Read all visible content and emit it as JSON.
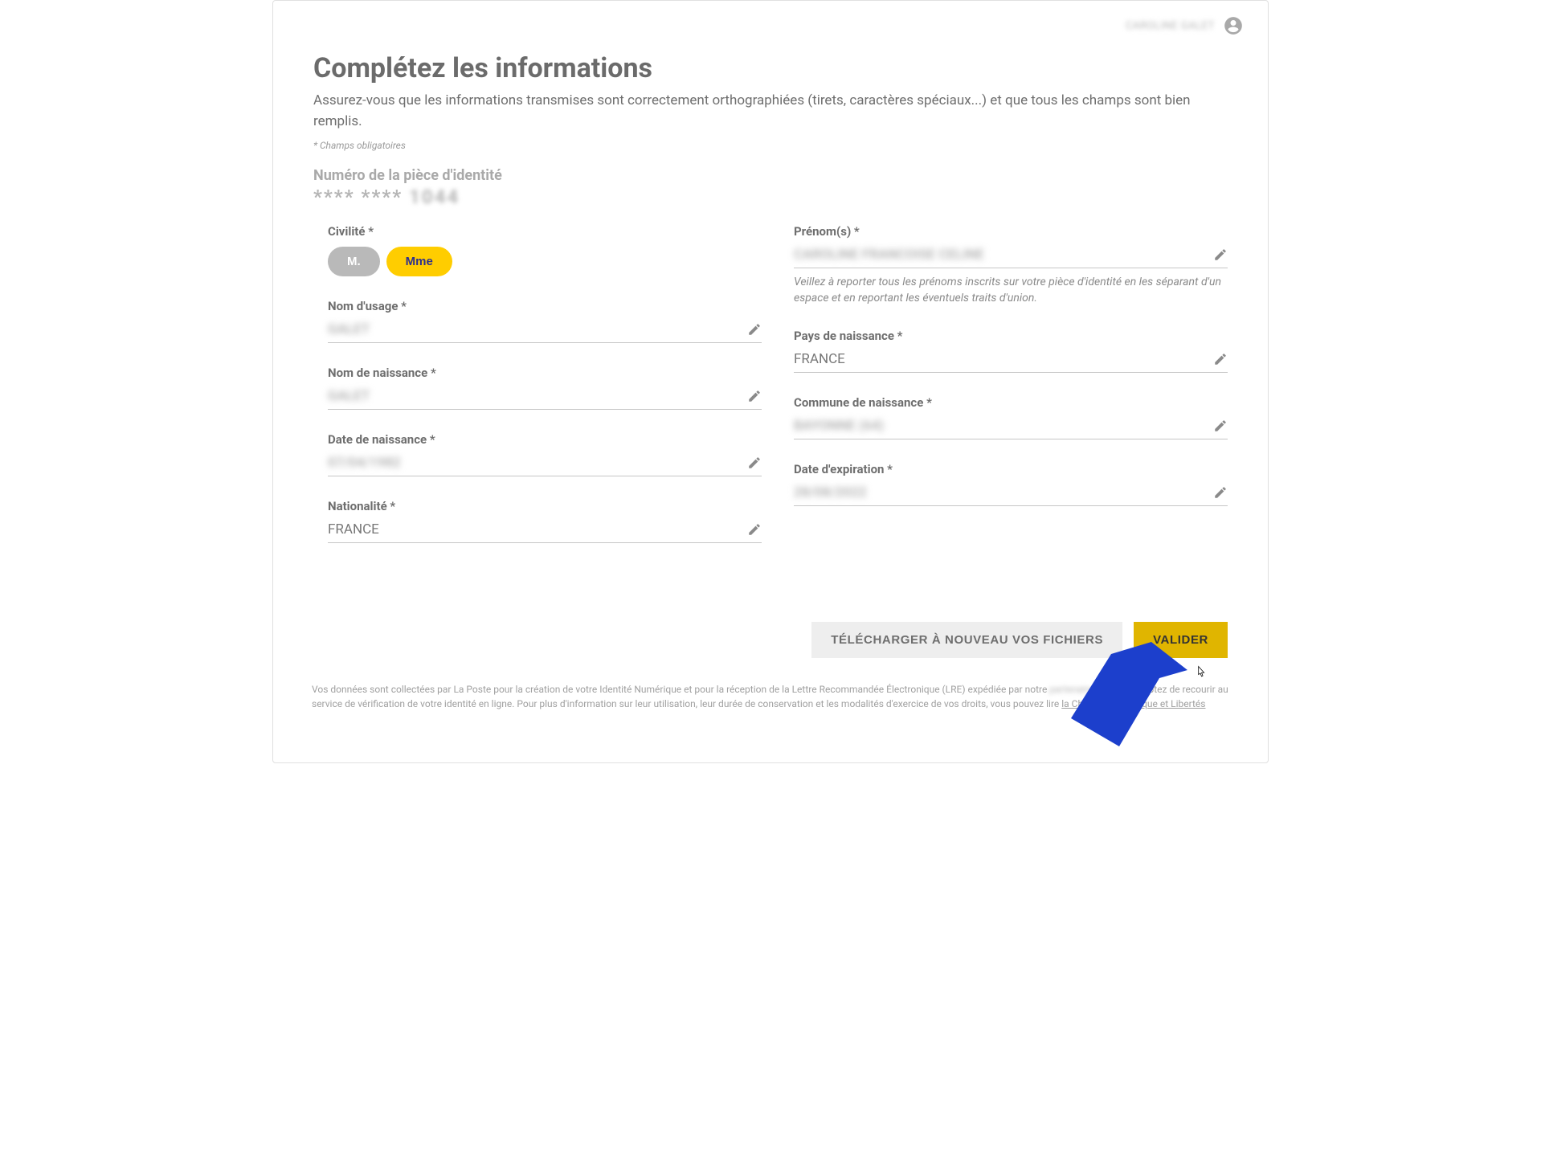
{
  "header": {
    "user_name": "CAROLINE GALET"
  },
  "page": {
    "title": "Complétez les informations",
    "subtitle": "Assurez-vous que les informations transmises sont correctement orthographiées (tirets, caractères spéciaux...) et que tous les champs sont bien remplis.",
    "required_note": "* Champs obligatoires",
    "id_label": "Numéro de la pièce d'identité",
    "id_masked": "**** **** ",
    "id_suffix": "1044"
  },
  "form": {
    "civility": {
      "label": "Civilité *",
      "options": {
        "m": "M.",
        "mme": "Mme"
      },
      "selected": "mme"
    },
    "usage_name": {
      "label": "Nom d'usage *",
      "value": "GALET"
    },
    "birth_name": {
      "label": "Nom de naissance *",
      "value": "GALET"
    },
    "birth_date": {
      "label": "Date de naissance *",
      "value": "07/04/1982"
    },
    "nationality": {
      "label": "Nationalité *",
      "value": "FRANCE"
    },
    "first_names": {
      "label": "Prénom(s) *",
      "value": "CAROLINE FRANCOISE CELINE",
      "hint": "Veillez à reporter tous les prénoms inscrits sur votre pièce d'identité en les séparant d'un espace et en reportant les éventuels traits d'union."
    },
    "birth_country": {
      "label": "Pays de naissance *",
      "value": "FRANCE"
    },
    "birth_commune": {
      "label": "Commune de naissance *",
      "value": "BAYONNE (64)"
    },
    "expiry_date": {
      "label": "Date d'expiration *",
      "value": "28/08/2022"
    }
  },
  "buttons": {
    "reupload": "TÉLÉCHARGER À NOUVEAU VOS FICHIERS",
    "validate": "VALIDER"
  },
  "legal": {
    "prefix": "Vos données sont collectées par La Poste pour la création de votre Identité Numérique et pour la réception de la Lettre Recommandée Électronique (LRE) expédiée par notre ",
    "blurred": "partenaire",
    "middle": " si vous acceptez de recourir au service de vérification de votre identité en ligne. Pour plus d'information sur leur utilisation, leur durée de conservation et les modalités d'exercice de vos droits, vous pouvez lire ",
    "link": "la Charte Informatique et Libertés"
  }
}
